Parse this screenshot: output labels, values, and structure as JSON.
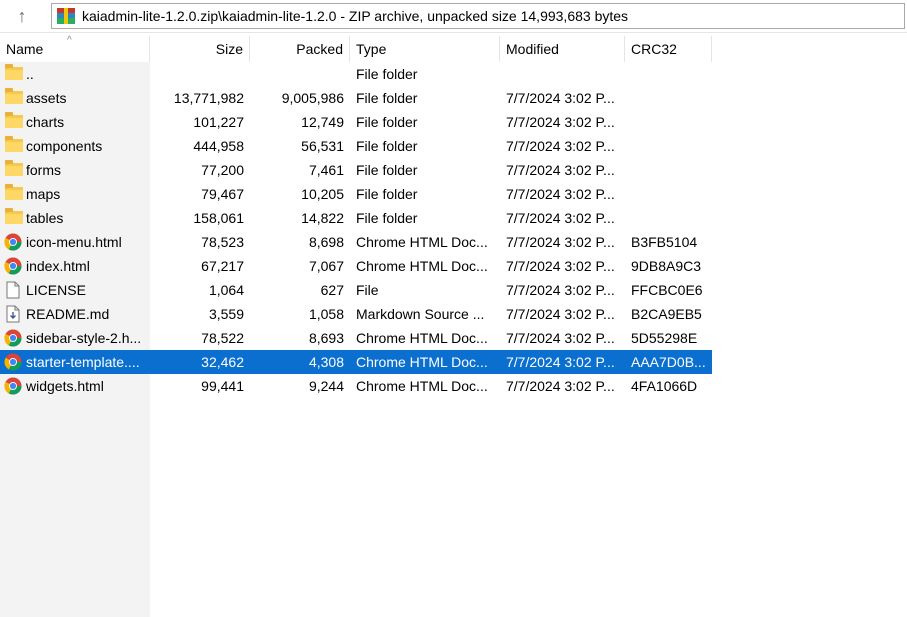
{
  "address_bar": {
    "path": "kaiadmin-lite-1.2.0.zip\\kaiadmin-lite-1.2.0 - ZIP archive, unpacked size 14,993,683 bytes",
    "icon": "winrar-archive-icon"
  },
  "toolbar": {
    "up_icon": "↑"
  },
  "columns": {
    "name": "Name",
    "size": "Size",
    "packed": "Packed",
    "type": "Type",
    "modified": "Modified",
    "crc32": "CRC32",
    "sort_indicator": "^"
  },
  "colors": {
    "selection": "#0a6fce",
    "folder": "#ffd766",
    "chrome_red": "#db4437",
    "chrome_yellow": "#f4b400",
    "chrome_green": "#0f9d58",
    "chrome_blue": "#4285f4"
  },
  "rows": [
    {
      "name": "..",
      "size": "",
      "packed": "",
      "type": "File folder",
      "modified": "",
      "crc": "",
      "icon": "folder-icon",
      "selected": false
    },
    {
      "name": "assets",
      "size": "13,771,982",
      "packed": "9,005,986",
      "type": "File folder",
      "modified": "7/7/2024 3:02 P...",
      "crc": "",
      "icon": "folder-icon",
      "selected": false
    },
    {
      "name": "charts",
      "size": "101,227",
      "packed": "12,749",
      "type": "File folder",
      "modified": "7/7/2024 3:02 P...",
      "crc": "",
      "icon": "folder-icon",
      "selected": false
    },
    {
      "name": "components",
      "size": "444,958",
      "packed": "56,531",
      "type": "File folder",
      "modified": "7/7/2024 3:02 P...",
      "crc": "",
      "icon": "folder-icon",
      "selected": false
    },
    {
      "name": "forms",
      "size": "77,200",
      "packed": "7,461",
      "type": "File folder",
      "modified": "7/7/2024 3:02 P...",
      "crc": "",
      "icon": "folder-icon",
      "selected": false
    },
    {
      "name": "maps",
      "size": "79,467",
      "packed": "10,205",
      "type": "File folder",
      "modified": "7/7/2024 3:02 P...",
      "crc": "",
      "icon": "folder-icon",
      "selected": false
    },
    {
      "name": "tables",
      "size": "158,061",
      "packed": "14,822",
      "type": "File folder",
      "modified": "7/7/2024 3:02 P...",
      "crc": "",
      "icon": "folder-icon",
      "selected": false
    },
    {
      "name": "icon-menu.html",
      "size": "78,523",
      "packed": "8,698",
      "type": "Chrome HTML Doc...",
      "modified": "7/7/2024 3:02 P...",
      "crc": "B3FB5104",
      "icon": "chrome-icon",
      "selected": false
    },
    {
      "name": "index.html",
      "size": "67,217",
      "packed": "7,067",
      "type": "Chrome HTML Doc...",
      "modified": "7/7/2024 3:02 P...",
      "crc": "9DB8A9C3",
      "icon": "chrome-icon",
      "selected": false
    },
    {
      "name": "LICENSE",
      "size": "1,064",
      "packed": "627",
      "type": "File",
      "modified": "7/7/2024 3:02 P...",
      "crc": "FFCBC0E6",
      "icon": "file-icon",
      "selected": false
    },
    {
      "name": "README.md",
      "size": "3,559",
      "packed": "1,058",
      "type": "Markdown Source ...",
      "modified": "7/7/2024 3:02 P...",
      "crc": "B2CA9EB5",
      "icon": "markdown-file-icon",
      "selected": false
    },
    {
      "name": "sidebar-style-2.h...",
      "size": "78,522",
      "packed": "8,693",
      "type": "Chrome HTML Doc...",
      "modified": "7/7/2024 3:02 P...",
      "crc": "5D55298E",
      "icon": "chrome-icon",
      "selected": false
    },
    {
      "name": "starter-template....",
      "size": "32,462",
      "packed": "4,308",
      "type": "Chrome HTML Doc...",
      "modified": "7/7/2024 3:02 P...",
      "crc": "AAA7D0B...",
      "icon": "chrome-icon",
      "selected": true
    },
    {
      "name": "widgets.html",
      "size": "99,441",
      "packed": "9,244",
      "type": "Chrome HTML Doc...",
      "modified": "7/7/2024 3:02 P...",
      "crc": "4FA1066D",
      "icon": "chrome-icon",
      "selected": false
    }
  ]
}
